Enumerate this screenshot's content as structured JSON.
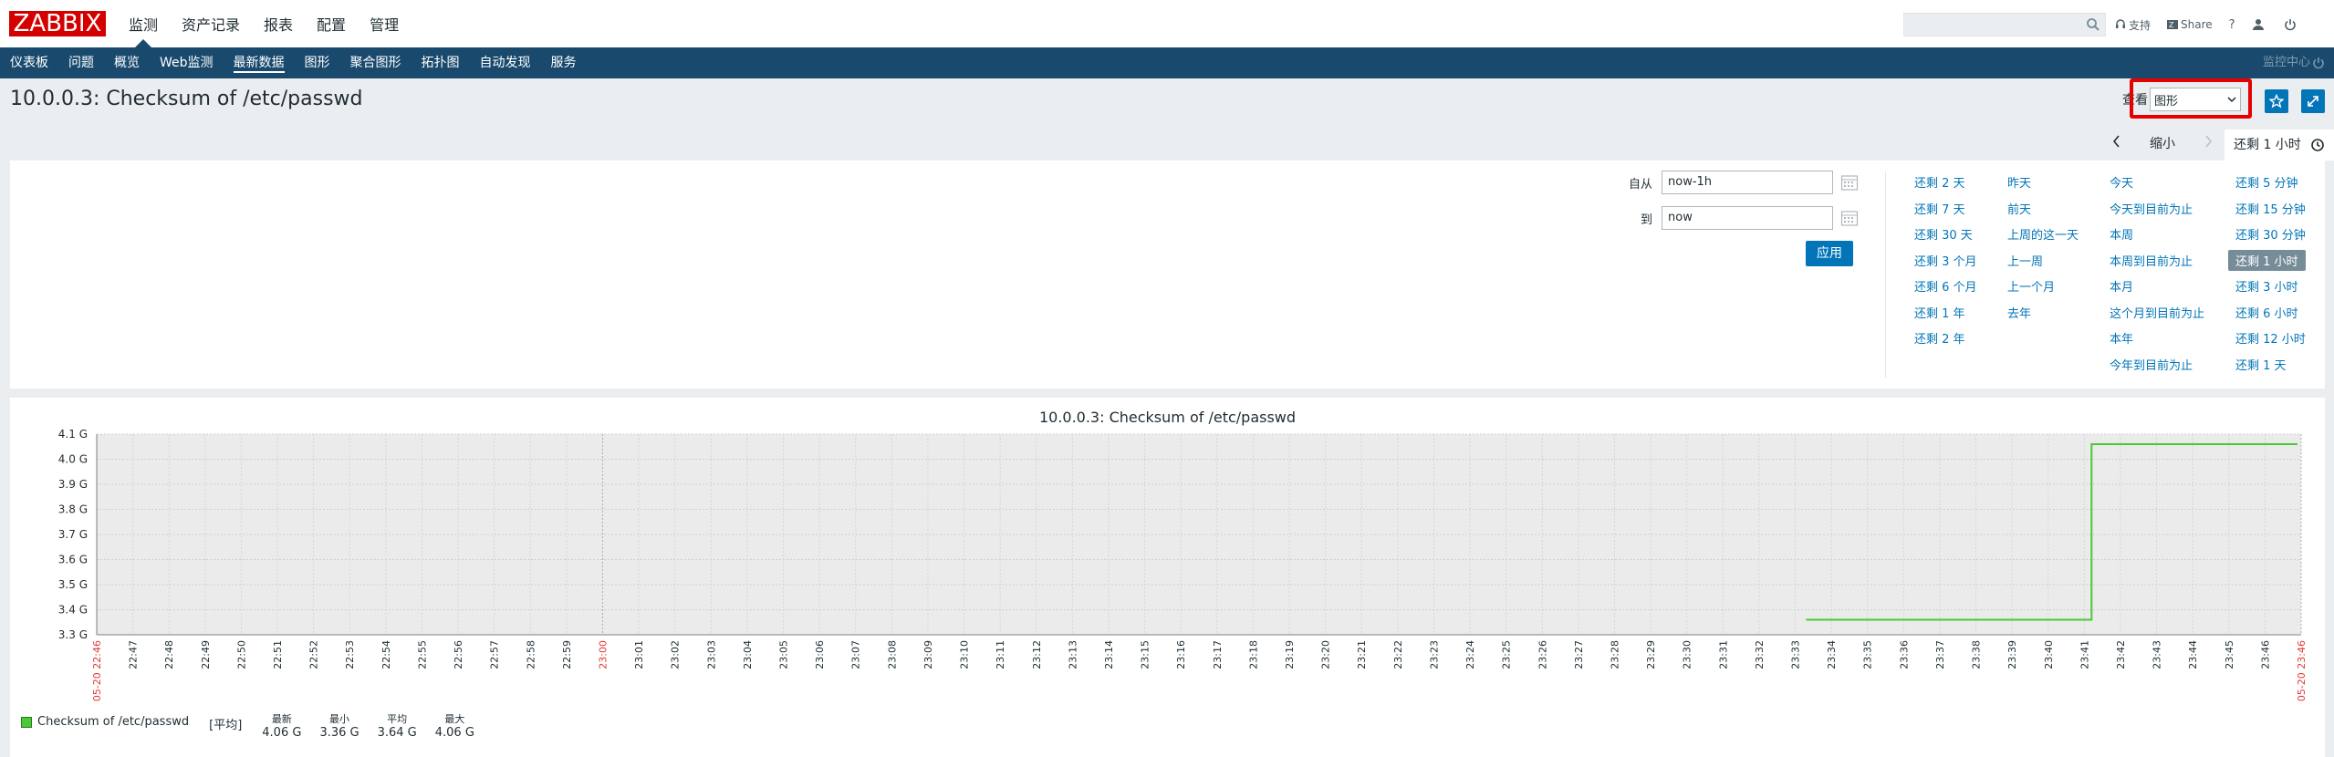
{
  "logo": "ZABBIX",
  "top_menu": [
    "监测",
    "资产记录",
    "报表",
    "配置",
    "管理"
  ],
  "top_menu_active": 0,
  "top_right": {
    "support": "支持",
    "share": "Share",
    "help": "?"
  },
  "sub_menu": [
    "仪表板",
    "问题",
    "概览",
    "Web监测",
    "最新数据",
    "图形",
    "聚合图形",
    "拓扑图",
    "自动发现",
    "服务"
  ],
  "sub_menu_active": 4,
  "kiosk_label": "监控中心",
  "page_title": "10.0.0.3: Checksum of /etc/passwd",
  "view": {
    "label": "查看",
    "selected": "图形"
  },
  "time_bar": {
    "zoom_out": "缩小",
    "tab_label": "还剩 1 小时"
  },
  "filter": {
    "from_label": "自从",
    "from_value": "now-1h",
    "to_label": "到",
    "to_value": "now",
    "apply": "应用"
  },
  "quick_ranges": [
    [
      "还剩 2 天",
      "还剩 7 天",
      "还剩 30 天",
      "还剩 3 个月",
      "还剩 6 个月",
      "还剩 1 年",
      "还剩 2 年"
    ],
    [
      "昨天",
      "前天",
      "上周的这一天",
      "上一周",
      "上一个月",
      "去年"
    ],
    [
      "今天",
      "今天到目前为止",
      "本周",
      "本周到目前为止",
      "本月",
      "这个月到目前为止",
      "本年",
      "今年到目前为止"
    ],
    [
      "还剩 5 分钟",
      "还剩 15 分钟",
      "还剩 30 分钟",
      "还剩 1 小时",
      "还剩 3 小时",
      "还剩 6 小时",
      "还剩 12 小时",
      "还剩 1 天"
    ]
  ],
  "quick_selected": [
    3,
    3
  ],
  "chart_data": {
    "type": "line",
    "title": "10.0.0.3: Checksum of /etc/passwd",
    "y_ticks": [
      "4.1 G",
      "4.0 G",
      "3.9 G",
      "3.8 G",
      "3.7 G",
      "3.6 G",
      "3.5 G",
      "3.4 G",
      "3.3 G"
    ],
    "ylim": [
      3.3,
      4.1
    ],
    "x_ticks": [
      "05-20 22:46",
      "22:47",
      "22:48",
      "22:49",
      "22:50",
      "22:51",
      "22:52",
      "22:53",
      "22:54",
      "22:55",
      "22:56",
      "22:57",
      "22:58",
      "22:59",
      "23:00",
      "23:01",
      "23:02",
      "23:03",
      "23:04",
      "23:05",
      "23:06",
      "23:07",
      "23:08",
      "23:09",
      "23:10",
      "23:11",
      "23:12",
      "23:13",
      "23:14",
      "23:15",
      "23:16",
      "23:17",
      "23:18",
      "23:19",
      "23:20",
      "23:21",
      "23:22",
      "23:23",
      "23:24",
      "23:25",
      "23:26",
      "23:27",
      "23:28",
      "23:29",
      "23:30",
      "23:31",
      "23:32",
      "23:33",
      "23:34",
      "23:35",
      "23:36",
      "23:37",
      "23:38",
      "23:39",
      "23:40",
      "23:41",
      "23:42",
      "23:43",
      "23:44",
      "23:45",
      "23:46",
      "05-20 23:46"
    ],
    "x_tick_colors": {
      "0": "#e33734",
      "14": "#e33734",
      "61": "#e33734"
    },
    "series": [
      {
        "name": "Checksum of /etc/passwd",
        "color": "#4cc738",
        "points": [
          [
            47.3,
            3.36
          ],
          [
            55.2,
            3.36
          ],
          [
            55.2,
            4.06
          ],
          [
            60.9,
            4.06
          ]
        ]
      }
    ],
    "legend": {
      "name": "Checksum of /etc/passwd",
      "func": "[平均]",
      "headers": [
        "最新",
        "最小",
        "平均",
        "最大"
      ],
      "values": [
        "4.06 G",
        "3.36 G",
        "3.64 G",
        "4.06 G"
      ]
    }
  }
}
